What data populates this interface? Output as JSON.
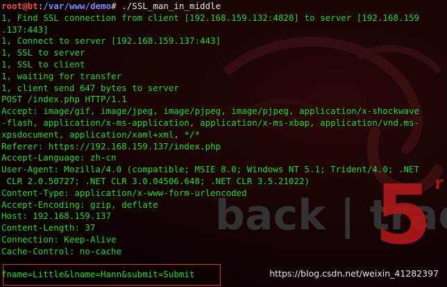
{
  "prompt": {
    "user_host": "root@bt",
    "separator": ":",
    "path": "/var/www/demo",
    "symbol": "#",
    "command": " ./SSL_man_in_middle"
  },
  "output_lines": [
    "1, Find SSL connection from client [192.168.159.132:4828] to server [192.168.159",
    ".137:443]",
    "1, Connect to server [192.168.159.137:443]",
    "1, SSL to server",
    "1, SSL to client",
    "1, waiting for transfer",
    "1, client send 647 bytes to server",
    "POST /index.php HTTP/1.1",
    "Accept: image/gif, image/jpeg, image/pjpeg, image/pjpeg, application/x-shockwave",
    "-flash, application/x-ms-application, application/x-ms-xbap, application/vnd.ms-",
    "xpsdocument, application/xaml+xml, */*",
    "Referer: https://192.168.159.137/index.php",
    "Accept-Language: zh-cn",
    "User-Agent: Mozilla/4.0 (compatible; MSIE 8.0; Windows NT 5.1; Trident/4.0; .NET",
    " CLR 2.0.50727; .NET CLR 3.0.04506.648; .NET CLR 3.5.21022)",
    "Content-Type: application/x-www-form-urlencoded",
    "Accept-Encoding: gzip, deflate",
    "Host: 192.168.159.137",
    "Content-Length: 37",
    "Connection: Keep-Alive",
    "Cache-Control: no-cache",
    "",
    "fname=Little&lname=Hann&submit=Submit"
  ],
  "wallpaper": {
    "brand_text": "back | track",
    "version": "5",
    "version_suffix": "r"
  },
  "watermark": "https://blog.csdn.net/weixin_41282397",
  "colors": {
    "output_text": "#22dd22",
    "prompt_user": "#ff4b4b",
    "prompt_path": "#7b8cff",
    "highlight_border": "#e03030",
    "background": "#120303"
  }
}
